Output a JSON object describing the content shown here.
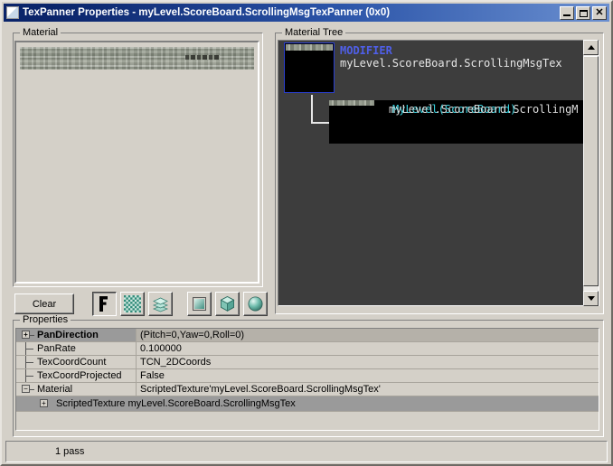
{
  "window": {
    "title": "TexPanner Properties - myLevel.ScoreBoard.ScrollingMsgTexPanner (0x0)",
    "icon": "window-icon",
    "buttons": {
      "minimize": "_",
      "maximize": "□",
      "close": "✕"
    }
  },
  "material_panel": {
    "label": "Material",
    "preview_name": "material-preview"
  },
  "toolbar": {
    "clear_label": "Clear",
    "buttons": [
      {
        "name": "show-background-f",
        "icon": "letter-f-icon",
        "pressed": true
      },
      {
        "name": "show-checker",
        "icon": "checker-icon",
        "pressed": false
      },
      {
        "name": "show-layers",
        "icon": "layers-icon",
        "pressed": false
      },
      {
        "name": "preview-plane",
        "icon": "plane-icon",
        "pressed": false
      },
      {
        "name": "preview-cube",
        "icon": "cube-icon",
        "pressed": false
      },
      {
        "name": "preview-sphere",
        "icon": "sphere-icon",
        "pressed": false
      }
    ]
  },
  "tree_panel": {
    "label": "Material Tree",
    "nodes": [
      {
        "type": "MODIFIER",
        "name": "myLevel.ScoreBoard.ScrollingMsgTex",
        "selected": true
      },
      {
        "type": "",
        "name": "myLevel.ScoreBoard.ScrollingM",
        "name_overlay": "MyLevel(ScoreBoard)",
        "selected": false
      }
    ],
    "scrollbar": {
      "up_arrow": "scroll-up-arrow",
      "down_arrow": "scroll-down-arrow"
    }
  },
  "properties_panel": {
    "label": "Properties",
    "rows": [
      {
        "name": "PanDirection",
        "value": "(Pitch=0,Yaw=0,Roll=0)",
        "expander": "+",
        "selected": true,
        "has_expander": true,
        "last": false
      },
      {
        "name": "PanRate",
        "value": "0.100000",
        "expander": "",
        "selected": false,
        "has_expander": false,
        "last": false
      },
      {
        "name": "TexCoordCount",
        "value": "TCN_2DCoords",
        "expander": "",
        "selected": false,
        "has_expander": false,
        "last": false
      },
      {
        "name": "TexCoordProjected",
        "value": "False",
        "expander": "",
        "selected": false,
        "has_expander": false,
        "last": true
      },
      {
        "name": "Material",
        "value": "ScriptedTexture'myLevel.ScoreBoard.ScrollingMsgTex'",
        "expander": "−",
        "selected": false,
        "has_expander": true,
        "last": false
      }
    ],
    "subrow": {
      "expander": "+",
      "label": "ScriptedTexture myLevel.ScoreBoard.ScrollingMsgTex"
    }
  },
  "statusbar": {
    "text": "1 pass"
  },
  "colors": {
    "face": "#d4d0c8",
    "title_active": "#0a246a",
    "tree_bg": "#3d3d3d",
    "tree_selected_band": "#5d6a5e",
    "prop_selected": "#9a9a9a",
    "modifier_text": "#4f5fe8"
  }
}
